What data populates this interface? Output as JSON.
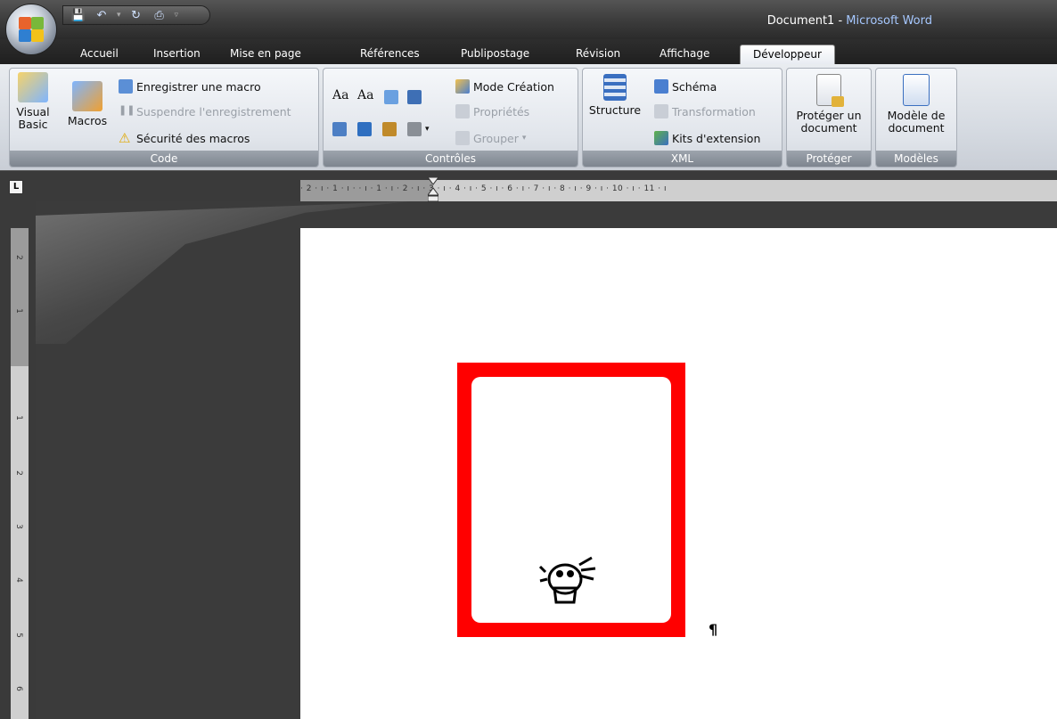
{
  "window": {
    "document_name": "Document1",
    "separator": " - ",
    "app_name": "Microsoft Word"
  },
  "tabs": [
    {
      "label": "Accueil"
    },
    {
      "label": "Insertion"
    },
    {
      "label": "Mise en page"
    },
    {
      "label": "Références"
    },
    {
      "label": "Publipostage"
    },
    {
      "label": "Révision"
    },
    {
      "label": "Affichage"
    },
    {
      "label": "Développeur",
      "active": true
    }
  ],
  "ribbon": {
    "code": {
      "label": "Code",
      "visual_basic": "Visual Basic",
      "visual_basic_l1": "Visual",
      "visual_basic_l2": "Basic",
      "macros": "Macros",
      "record_macro": "Enregistrer une macro",
      "pause_recording": "Suspendre l'enregistrement",
      "macro_security": "Sécurité des macros"
    },
    "controls": {
      "label": "Contrôles",
      "rich_text": "Aa",
      "plain_text": "Aa",
      "design_mode": "Mode Création",
      "properties": "Propriétés",
      "group": "Grouper"
    },
    "xml": {
      "label": "XML",
      "structure": "Structure",
      "schema": "Schéma",
      "transformation": "Transformation",
      "expansion_packs": "Kits d'extension"
    },
    "protect": {
      "label": "Protéger",
      "protect_document_l1": "Protéger un",
      "protect_document_l2": "document"
    },
    "templates": {
      "label": "Modèles",
      "document_template_l1": "Modèle de",
      "document_template_l2": "document"
    }
  },
  "ruler": {
    "horizontal": "· 2 · ı · 1 · ı ·   · ı · 1 · ı · 2 · ı · 3 · ı · 4 · ı · 5 · ı · 6 · ı · 7 · ı · 8 · ı · 9 · ı · 10 · ı · 11 · ı",
    "vertical": [
      "2",
      "1",
      "1",
      "2",
      "3",
      "4",
      "5",
      "6"
    ],
    "tab_selector": "L"
  },
  "document": {
    "paragraph_mark": "¶"
  },
  "colors": {
    "frame": "#ff0000",
    "accent_tab": "#ffffff",
    "title_app": "#a6c8ff"
  }
}
